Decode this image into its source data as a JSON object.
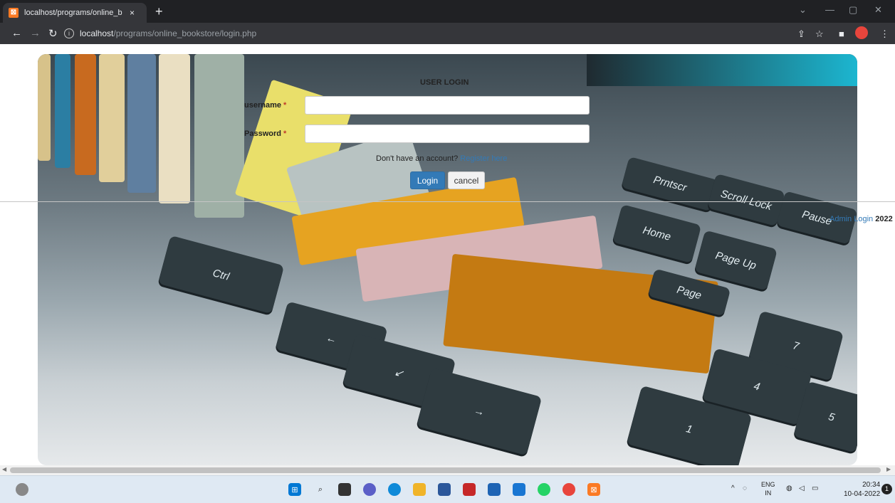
{
  "browser": {
    "tab_title": "localhost/programs/online_book",
    "tab_close": "×",
    "new_tab": "+",
    "url_host": "localhost",
    "url_path": "/programs/online_bookstore/login.php",
    "icons": [
      "back-arrow-icon",
      "forward-arrow-icon",
      "reload-icon",
      "info-icon",
      "share-icon",
      "star-icon",
      "sidebar-icon",
      "profile-icon",
      "menu-icon"
    ]
  },
  "form": {
    "title": "USER LOGIN",
    "username_label": "username",
    "password_label": "Password",
    "required_marker": "*",
    "username_value": "",
    "password_value": "",
    "register_prompt": "Don't have an account? ",
    "register_link": "Register here",
    "login_button": "Login",
    "cancel_button": "cancel"
  },
  "footer": {
    "admin_link": "Admin Login",
    "year": "2022"
  },
  "hero_keys": [
    "Prntscr",
    "Scroll Lock",
    "Pause",
    "Home",
    "Page Up",
    "Page",
    "Ctrl",
    "7",
    "4",
    "1",
    "5"
  ],
  "taskbar": {
    "tray_lang_top": "ENG",
    "tray_lang_bottom": "IN",
    "time": "20:34",
    "date": "10-04-2022",
    "notification_count": "1",
    "colors": {
      "background": "#dfe9f3",
      "accent": "#337ab7"
    }
  }
}
